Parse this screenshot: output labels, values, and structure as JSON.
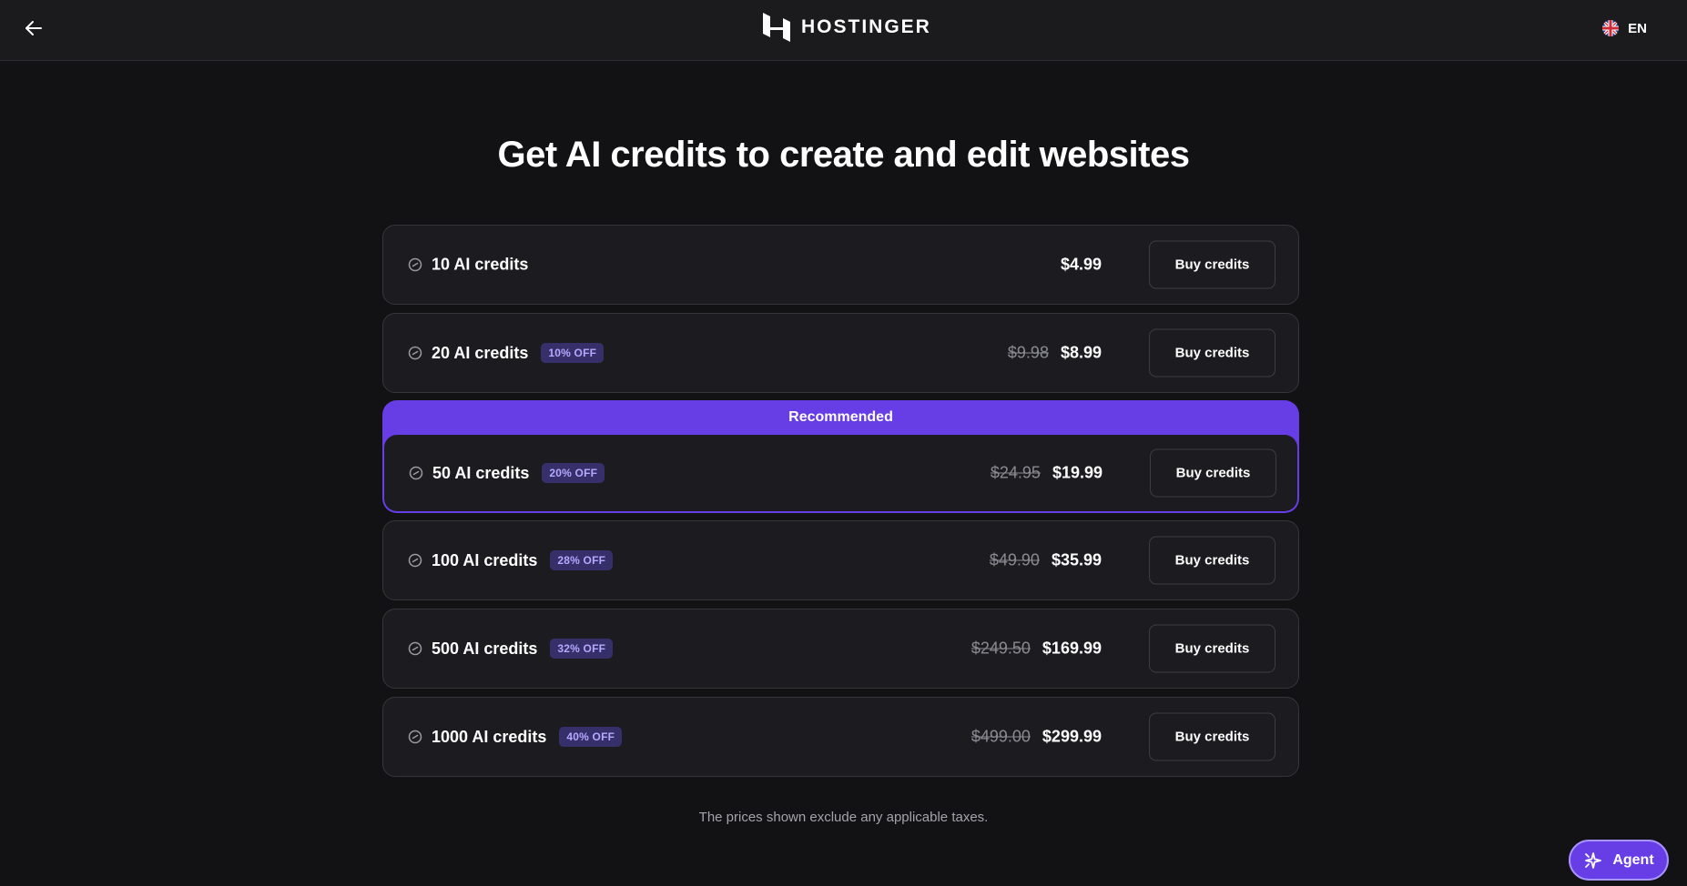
{
  "header": {
    "logo_text": "HOSTINGER",
    "language_code": "EN"
  },
  "title": "Get AI credits to create and edit websites",
  "recommended_label": "Recommended",
  "plans": [
    {
      "label": "10 AI credits",
      "badge": "",
      "old_price": "",
      "price": "$4.99",
      "button": "Buy credits"
    },
    {
      "label": "20 AI credits",
      "badge": "10% OFF",
      "old_price": "$9.98",
      "price": "$8.99",
      "button": "Buy credits"
    },
    {
      "label": "50 AI credits",
      "badge": "20% OFF",
      "old_price": "$24.95",
      "price": "$19.99",
      "button": "Buy credits"
    },
    {
      "label": "100 AI credits",
      "badge": "28% OFF",
      "old_price": "$49.90",
      "price": "$35.99",
      "button": "Buy credits"
    },
    {
      "label": "500 AI credits",
      "badge": "32% OFF",
      "old_price": "$249.50",
      "price": "$169.99",
      "button": "Buy credits"
    },
    {
      "label": "1000 AI credits",
      "badge": "40% OFF",
      "old_price": "$499.00",
      "price": "$299.99",
      "button": "Buy credits"
    }
  ],
  "footnote": "The prices shown exclude any applicable taxes.",
  "agent_button": "Agent",
  "colors": {
    "accent": "#673de6",
    "badge_text": "#b5a8ff",
    "background": "#121214",
    "card": "#1c1c20"
  },
  "icons": {
    "back": "arrow-left-icon",
    "credit": "credit-coin-icon",
    "language": "uk-flag-icon",
    "agent": "agent-sparkle-icon"
  }
}
